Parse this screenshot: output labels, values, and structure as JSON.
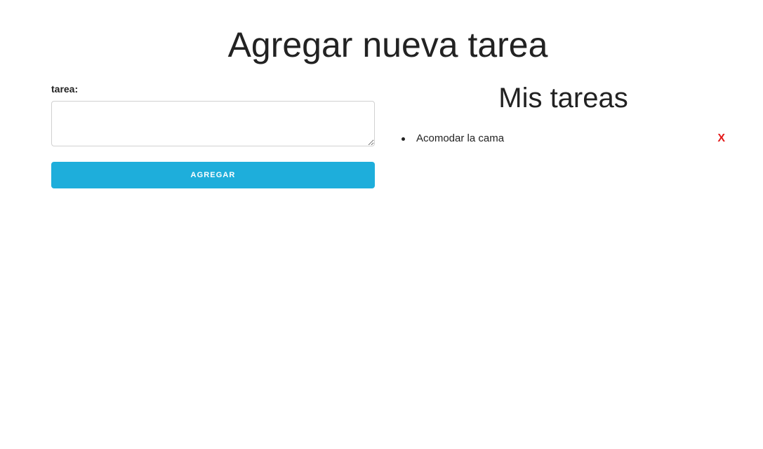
{
  "header": {
    "title": "Agregar nueva tarea"
  },
  "form": {
    "label": "tarea:",
    "textarea_value": "",
    "textarea_placeholder": "",
    "submit_label": "AGREGAR"
  },
  "tasks": {
    "title": "Mis tareas",
    "items": [
      {
        "text": "Acomodar la cama",
        "delete_label": "X"
      }
    ]
  },
  "colors": {
    "accent": "#1eaedb",
    "delete": "#e31b1b",
    "text": "#222222",
    "border": "#d1d1d1"
  }
}
